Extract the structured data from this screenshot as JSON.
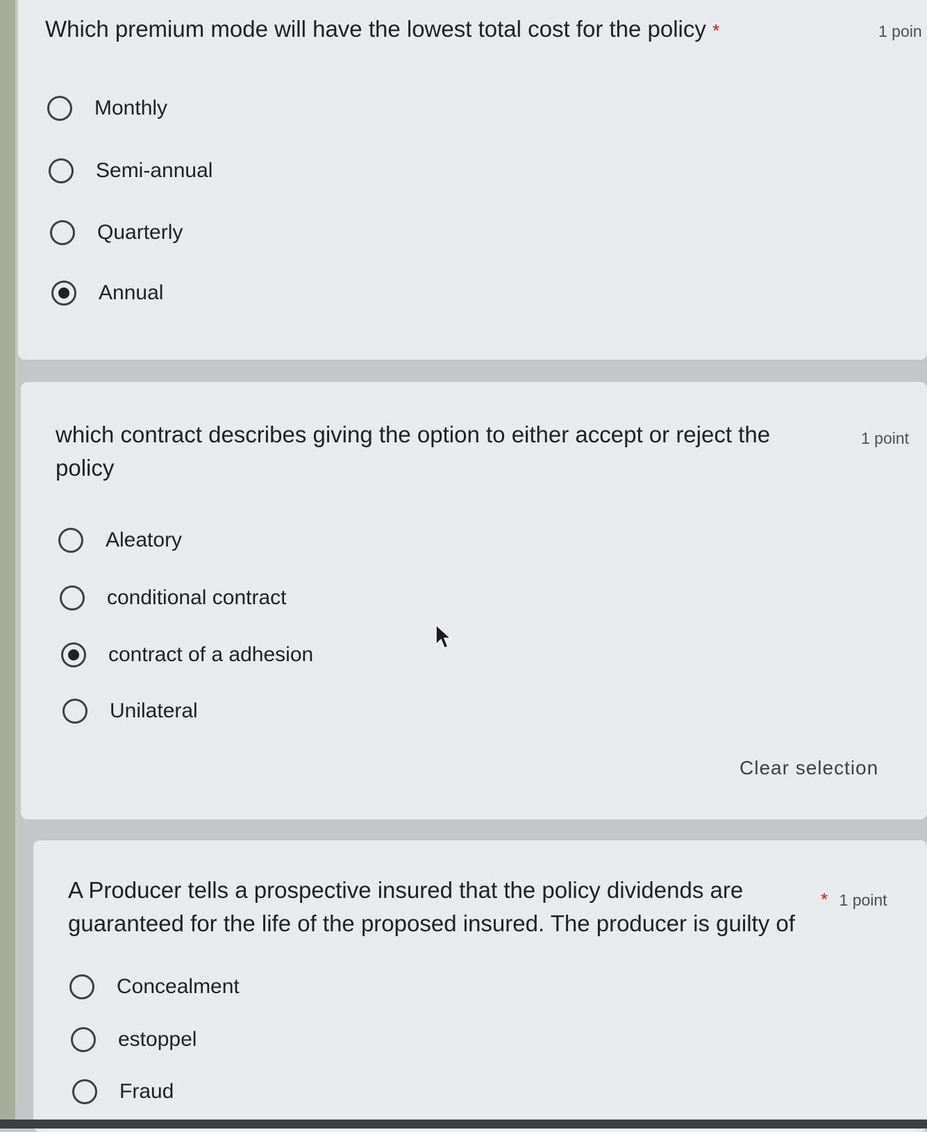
{
  "questions": [
    {
      "title": "Which premium mode will have the lowest total cost for the policy",
      "required": "*",
      "points": "1 poin",
      "options": [
        {
          "label": "Monthly",
          "selected": false
        },
        {
          "label": "Semi-annual",
          "selected": false
        },
        {
          "label": "Quarterly",
          "selected": false
        },
        {
          "label": "Annual",
          "selected": true
        }
      ]
    },
    {
      "title_line1": "which contract describes giving the option to either accept or reject the",
      "title_line2": "policy",
      "points": "1 point",
      "options": [
        {
          "label": "Aleatory",
          "selected": false
        },
        {
          "label": "conditional contract",
          "selected": false
        },
        {
          "label": "contract of a adhesion",
          "selected": true
        },
        {
          "label": "Unilateral",
          "selected": false
        }
      ],
      "clear_label": "Clear selection"
    },
    {
      "title_line1": "A Producer tells a prospective insured that the policy dividends are",
      "title_line2": "guaranteed for the life of the proposed insured. The producer is guilty of",
      "required": "*",
      "points": "1 point",
      "options": [
        {
          "label": "Concealment",
          "selected": false
        },
        {
          "label": "estoppel",
          "selected": false
        },
        {
          "label": "Fraud",
          "selected": false
        }
      ]
    }
  ]
}
